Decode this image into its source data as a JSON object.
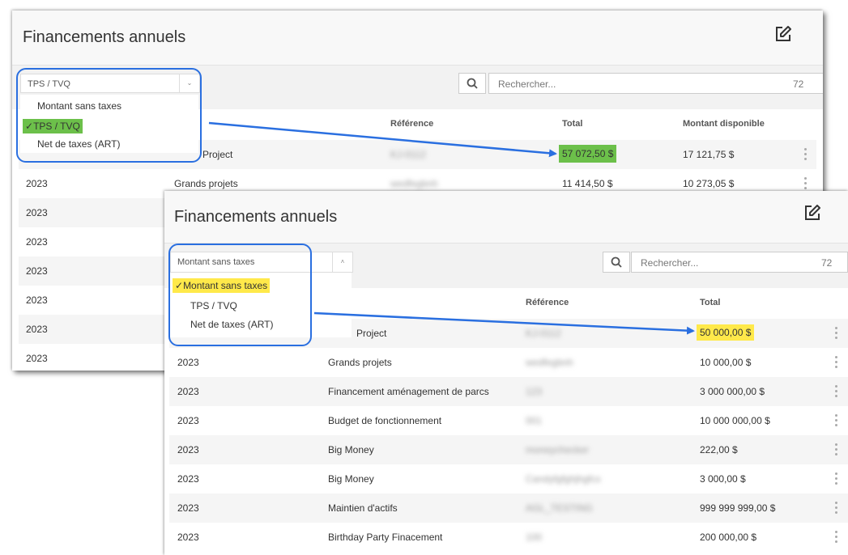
{
  "back": {
    "title": "Financements annuels",
    "select_value": "TPS / TVQ",
    "search_placeholder": "Rechercher...",
    "count": "72",
    "columns": {
      "reference": "Référence",
      "total": "Total",
      "available": "Montant disponible"
    },
    "dropdown": [
      "Montant sans taxes",
      "TPS / TVQ",
      "Net de taxes (ART)"
    ],
    "selected_option": "TPS / TVQ",
    "rows": [
      {
        "year": "",
        "name": "Project",
        "ref": "KJ-0112",
        "total": "57 072,50 $",
        "available": "17 121,75 $"
      },
      {
        "year": "2023",
        "name": "Grands projets",
        "ref": "wedfegbnh",
        "total": "11 414,50 $",
        "available": "10 273,05 $"
      },
      {
        "year": "2023"
      },
      {
        "year": "2023"
      },
      {
        "year": "2023"
      },
      {
        "year": "2023"
      },
      {
        "year": "2023"
      },
      {
        "year": "2023"
      }
    ]
  },
  "front": {
    "title": "Financements annuels",
    "select_value": "Montant sans taxes",
    "search_placeholder": "Rechercher...",
    "count": "72",
    "columns": {
      "reference": "Référence",
      "total": "Total"
    },
    "dropdown": [
      "Montant sans taxes",
      "TPS / TVQ",
      "Net de taxes (ART)"
    ],
    "selected_option": "Montant sans taxes",
    "rows": [
      {
        "year": "",
        "name": "Project",
        "ref": "KJ-0112",
        "total": "50 000,00 $"
      },
      {
        "year": "2023",
        "name": "Grands projets",
        "ref": "wedfegbnh",
        "total": "10 000,00 $"
      },
      {
        "year": "2023",
        "name": "Financement aménagement de parcs",
        "ref": "123",
        "total": "3 000 000,00 $"
      },
      {
        "year": "2023",
        "name": "Budget de fonctionnement",
        "ref": "001",
        "total": "10 000 000,00 $"
      },
      {
        "year": "2023",
        "name": "Big Money",
        "ref": "moneychecker",
        "total": "222,00 $"
      },
      {
        "year": "2023",
        "name": "Big Money",
        "ref": "Candyfgfghjhgfcx",
        "total": "3 000,00 $"
      },
      {
        "year": "2023",
        "name": "Maintien d'actifs",
        "ref": "AGL_TESTING",
        "total": "999 999 999,00 $"
      },
      {
        "year": "2023",
        "name": "Birthday Party Finacement",
        "ref": "100",
        "total": "200 000,00 $"
      }
    ]
  },
  "icons": {
    "edit": "edit-square-icon",
    "search": "search-icon",
    "kebab": "more-vertical-icon",
    "check": "checkmark-icon",
    "caret": "chevron-down-icon"
  },
  "colors": {
    "callout": "#2a6fe0",
    "highlight_green": "#6cc04a",
    "highlight_yellow": "#ffe94a"
  }
}
